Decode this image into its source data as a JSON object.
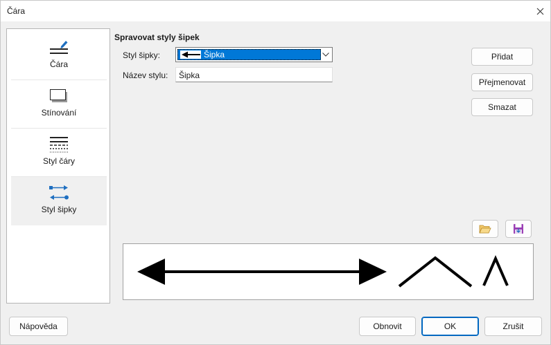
{
  "window": {
    "title": "Čára"
  },
  "sidebar": {
    "items": [
      {
        "label": "Čára",
        "icon": "line-pencil-icon"
      },
      {
        "label": "Stínování",
        "icon": "shadow-icon"
      },
      {
        "label": "Styl čáry",
        "icon": "line-style-icon"
      },
      {
        "label": "Styl šipky",
        "icon": "arrow-style-icon"
      }
    ],
    "active_index": 3
  },
  "main": {
    "section_title": "Spravovat styly šipek",
    "arrow_style_label": "Styl šipky:",
    "arrow_style_value": "Šipka",
    "style_name_label": "Název stylu:",
    "style_name_value": "Šipka"
  },
  "actions": {
    "add": "Přidat",
    "rename": "Přejmenovat",
    "delete": "Smazat"
  },
  "file_icons": {
    "open": "folder-open-icon",
    "save": "save-icon"
  },
  "footer": {
    "help": "Nápověda",
    "reset": "Obnovit",
    "ok": "OK",
    "cancel": "Zrušit"
  },
  "colors": {
    "accent": "#0078d7",
    "sidebar_icon": "#1f6fc0"
  }
}
